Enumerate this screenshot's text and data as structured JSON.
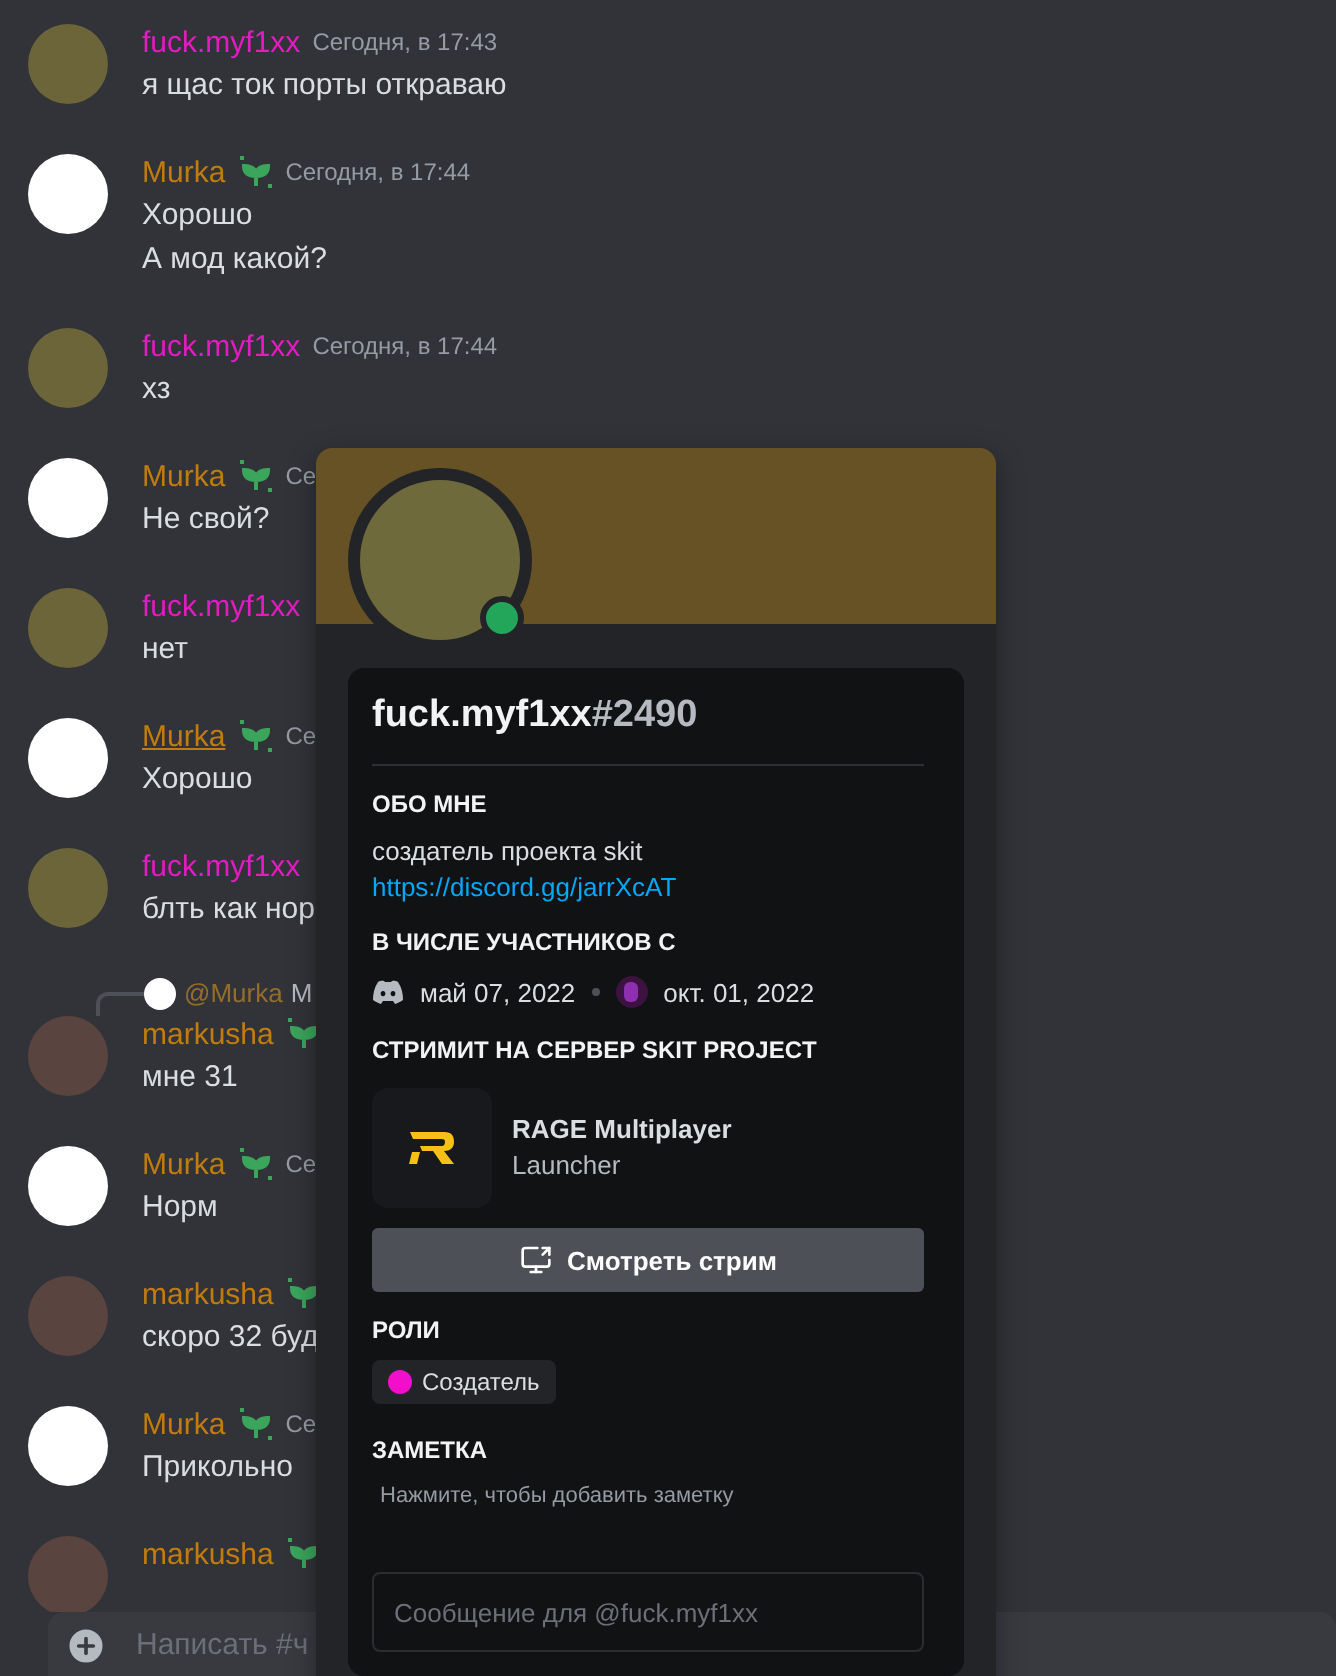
{
  "messages": [
    {
      "author": "fuck.myf1xx",
      "color": "#e21cc2",
      "kind": "photo",
      "badge": false,
      "underlined": false,
      "time": "Сегодня, в 17:43",
      "lines": [
        "я щас ток порты откраваю"
      ]
    },
    {
      "author": "Murka",
      "color": "#c27c0e",
      "kind": "cat",
      "badge": true,
      "underlined": false,
      "time": "Сегодня, в 17:44",
      "lines": [
        "Хорошо",
        "А мод какой?"
      ]
    },
    {
      "author": "fuck.myf1xx",
      "color": "#e21cc2",
      "kind": "photo",
      "badge": false,
      "underlined": false,
      "time": "Сегодня, в 17:44",
      "lines": [
        "хз"
      ]
    },
    {
      "author": "Murka",
      "color": "#c27c0e",
      "kind": "cat",
      "badge": true,
      "underlined": false,
      "time": "Се",
      "lines": [
        "Не свой?"
      ]
    },
    {
      "author": "fuck.myf1xx",
      "color": "#e21cc2",
      "kind": "photo",
      "badge": false,
      "underlined": false,
      "lines": [
        "нет"
      ]
    },
    {
      "author": "Murka",
      "color": "#c27c0e",
      "kind": "cat",
      "badge": true,
      "underlined": true,
      "time": "Се",
      "lines": [
        "Хорошо"
      ]
    },
    {
      "author": "fuck.myf1xx",
      "color": "#e21cc2",
      "kind": "photo",
      "badge": false,
      "underlined": false,
      "lines": [
        "блть как нор"
      ]
    },
    {
      "author": "markusha",
      "color": "#c27c0e",
      "kind": "photo_dark",
      "badge": true,
      "underlined": false,
      "reply": {
        "mention": "@Murka",
        "text": "M"
      },
      "lines": [
        "мне 31"
      ]
    },
    {
      "author": "Murka",
      "color": "#c27c0e",
      "kind": "cat",
      "badge": true,
      "underlined": false,
      "time": "Се",
      "lines": [
        "Норм"
      ]
    },
    {
      "author": "markusha",
      "color": "#c27c0e",
      "kind": "photo_dark",
      "badge": true,
      "underlined": false,
      "lines": [
        "скоро 32 буд"
      ]
    },
    {
      "author": "Murka",
      "color": "#c27c0e",
      "kind": "cat",
      "badge": true,
      "underlined": false,
      "time": "Се",
      "lines": [
        "Прикольно"
      ]
    },
    {
      "author": "markusha",
      "color": "#c27c0e",
      "kind": "photo_dark",
      "badge": true,
      "underlined": false
    }
  ],
  "composer": {
    "placeholder": "Написать #ч"
  },
  "profile": {
    "username": "fuck.myf1xx",
    "discriminator": "#2490",
    "online": true,
    "about": {
      "heading": "ОБО МНЕ",
      "text": "создатель проекта skit",
      "link": "https://discord.gg/jarrXcAT"
    },
    "member_since": {
      "heading": "В ЧИСЛЕ УЧАСТНИКОВ С",
      "discord_date": "май 07, 2022",
      "server_date": "окт. 01, 2022"
    },
    "streaming": {
      "heading": "СТРИМИТ НА СЕРВЕР **SKIT PROJECT**",
      "game": "RAGE Multiplayer",
      "detail": "Launcher",
      "button": "Смотреть стрим"
    },
    "roles": {
      "heading": "РОЛИ",
      "items": [
        {
          "name": "Создатель",
          "color": "#f20fcc"
        }
      ]
    },
    "note": {
      "heading": "ЗАМЕТКА",
      "placeholder": "Нажмите, чтобы добавить заметку"
    },
    "message": {
      "placeholder": "Сообщение для @fuck.myf1xx"
    }
  }
}
